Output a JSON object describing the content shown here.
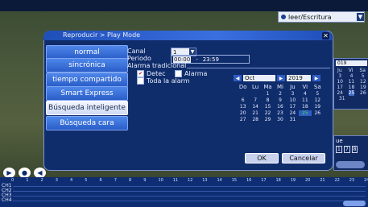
{
  "mode": {
    "label": "leer/Escritura"
  },
  "dialog": {
    "title": "Reproducir > Play Mode"
  },
  "menu": {
    "items": [
      "normal",
      "sincrónica",
      "tiempo compartido",
      "Smart Express",
      "Búsqueda inteligente",
      "Búsqueda cara"
    ],
    "selected": "Búsqueda inteligente"
  },
  "form": {
    "canal_label": "Canal",
    "canal_value": "1",
    "periodo_label": "Periodo",
    "period_start": "00:00",
    "period_sep": "-",
    "period_end": "23:59",
    "alarm_section": "Alarma tradicional",
    "detec_label": "Detec",
    "alarma_label": "Alarma",
    "toda_label": "Toda la alarm"
  },
  "calendar": {
    "month": "Oct",
    "year": "2019",
    "weekdays": [
      "Do",
      "Lu",
      "Ma",
      "Mi",
      "Ju",
      "Vi",
      "Sa"
    ],
    "days": [
      "",
      "",
      "1",
      "2",
      "3",
      "4",
      "5",
      "6",
      "7",
      "8",
      "9",
      "10",
      "11",
      "12",
      "13",
      "14",
      "15",
      "16",
      "17",
      "18",
      "19",
      "20",
      "21",
      "22",
      "23",
      "24",
      "25",
      "26",
      "27",
      "28",
      "29",
      "30",
      "31",
      "",
      ""
    ],
    "today": "25"
  },
  "buttons": {
    "ok": "OK",
    "cancel": "Cancelar"
  },
  "side_calendar": {
    "year": "019",
    "weekdays": [
      "Ju",
      "Vi",
      "Sa"
    ],
    "rows": [
      [
        "3",
        "4",
        "5"
      ],
      [
        "10",
        "11",
        "12"
      ],
      [
        "17",
        "18",
        "19"
      ],
      [
        "24",
        "25",
        "26"
      ],
      [
        "31",
        "",
        ""
      ]
    ]
  },
  "side_panel": {
    "label": "ue",
    "nums": [
      "1",
      "7",
      "8"
    ]
  },
  "timeline": {
    "hours": [
      "0",
      "1",
      "2",
      "3",
      "4",
      "5",
      "6",
      "7",
      "8",
      "9",
      "10",
      "11",
      "12",
      "13",
      "14",
      "15",
      "16",
      "17",
      "18",
      "19",
      "20",
      "21",
      "22",
      "23",
      "24"
    ],
    "channels": [
      "CH1",
      "CH2",
      "CH3",
      "CH4"
    ]
  }
}
